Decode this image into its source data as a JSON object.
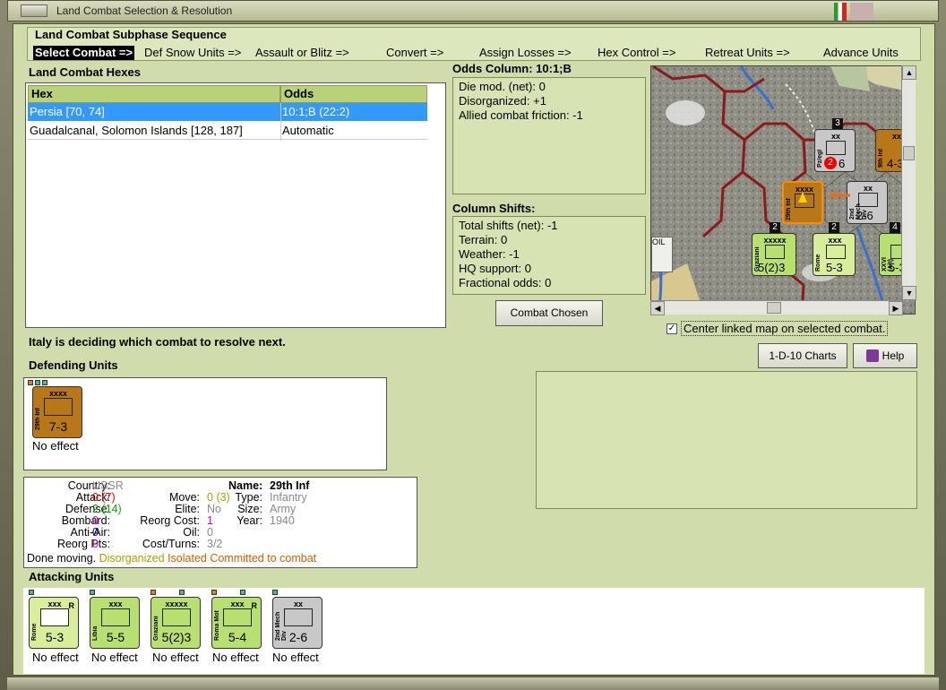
{
  "window": {
    "title": "Land Combat Selection & Resolution"
  },
  "sequence": {
    "heading": "Land Combat Subphase Sequence",
    "steps": [
      "Select Combat =>",
      "Def Snow Units =>",
      "Assault or Blitz =>",
      "Convert =>",
      "Assign Losses =>",
      "Hex Control =>",
      "Retreat Units =>",
      "Advance Units"
    ]
  },
  "hexes": {
    "heading": "Land Combat Hexes",
    "columns": [
      "Hex",
      "Odds"
    ],
    "rows": [
      {
        "hex": "Persia [70, 74]",
        "odds": "10:1;B (22:2)",
        "selected": true
      },
      {
        "hex": "Guadalcanal, Solomon Islands [128, 187]",
        "odds": "Automatic",
        "selected": false
      }
    ]
  },
  "odds": {
    "heading": "Odds Column: 10:1;B",
    "lines": [
      "Die mod. (net): 0",
      "Disorganized: +1",
      "Allied combat friction: -1"
    ]
  },
  "shifts": {
    "heading": "Column Shifts:",
    "lines": [
      "Total shifts (net): -1",
      "Terrain: 0",
      "Weather: -1",
      "HQ support: 0",
      "Fractional odds: 0"
    ]
  },
  "buttons": {
    "combat_chosen": "Combat Chosen",
    "charts": "1-D-10 Charts",
    "help": "Help"
  },
  "map": {
    "center_label": "Center linked map on selected combat.",
    "center_checked": true,
    "oil_label": "OIL",
    "units": [
      {
        "name": "Pz/egl",
        "size": "xx",
        "str": "6",
        "badge": "2",
        "stack": "3",
        "color": "#c8c8c8"
      },
      {
        "name": "9th Inf",
        "size": "xx",
        "str": "4-3",
        "color": "#b8781a"
      },
      {
        "name": "29th Inf",
        "size": "xxxx",
        "str": "",
        "color": "#b8781a"
      },
      {
        "name": "2nd Mech Div",
        "size": "xx",
        "str": "2-6",
        "color": "#c8c8c8"
      },
      {
        "name": "Graziani",
        "size": "xxxxx",
        "str": "5(2)3",
        "stack": "2",
        "color": "#b8e070"
      },
      {
        "name": "Rome",
        "size": "xxx",
        "str": "5-3",
        "stack": "2",
        "color": "#d8ee9a"
      },
      {
        "name": "XXVI (Alt)",
        "size": "",
        "str": "5-3",
        "stack": "4",
        "color": "#b8e070"
      }
    ]
  },
  "status": {
    "text": "Italy is deciding which combat to resolve next."
  },
  "defending": {
    "heading": "Defending Units",
    "units": [
      {
        "name": "29th Inf",
        "size": "xxxx",
        "str": "7-3",
        "result": "No effect",
        "color": "#b8781a"
      }
    ]
  },
  "unit_info": {
    "country_label": "Country:",
    "country": "USSR",
    "name_label": "Name:",
    "name": "29th Inf",
    "attack_label": "Attack:",
    "attack": "0",
    "attack_paren": "(7)",
    "defense_label": "Defense:",
    "defense": "2",
    "defense_paren": "(14)",
    "bombard_label": "Bombard:",
    "bombard": "0",
    "antiair_label": "Anti-Air:",
    "antiair": "0",
    "reorgpts_label": "Reorg Pts:",
    "reorgpts": "0",
    "move_label": "Move:",
    "move": "0",
    "move_paren": "(3)",
    "elite_label": "Elite:",
    "elite": "No",
    "reorgcost_label": "Reorg Cost:",
    "reorgcost": "1",
    "oil_label": "Oil:",
    "oil": "0",
    "costturns_label": "Cost/Turns:",
    "costturns": "3/2",
    "type_label": "Type:",
    "type": "Infantry",
    "size_label": "Size:",
    "size": "Army",
    "year_label": "Year:",
    "year": "1940",
    "done": "Done moving.",
    "disorganized": "Disorganized",
    "isolated": "Isolated",
    "committed": "Committed to combat"
  },
  "attacking": {
    "heading": "Attacking Units",
    "units": [
      {
        "name": "Rome",
        "size": "xxx",
        "str": "5-3",
        "tag": "R",
        "result": "No effect",
        "color": "#d8ee9a"
      },
      {
        "name": "Libia",
        "size": "xxx",
        "str": "5-5",
        "tag": "",
        "result": "No effect",
        "color": "#b8e070"
      },
      {
        "name": "Graziani",
        "size": "xxxxx",
        "str": "5(2)3",
        "tag": "",
        "result": "No effect",
        "color": "#b8e070"
      },
      {
        "name": "Roma Mot",
        "size": "xxx",
        "str": "5-4",
        "tag": "R",
        "result": "No effect",
        "color": "#b8e070"
      },
      {
        "name": "2nd Mech Div",
        "size": "xx",
        "str": "2-6",
        "tag": "",
        "result": "No effect",
        "color": "#c8c8c8"
      }
    ]
  },
  "colors": {
    "panel_bg": "#d0dcab",
    "header_green": "#b9d27a",
    "selection_blue": "#3399ff",
    "hex_border_red": "#8b1a1a"
  }
}
